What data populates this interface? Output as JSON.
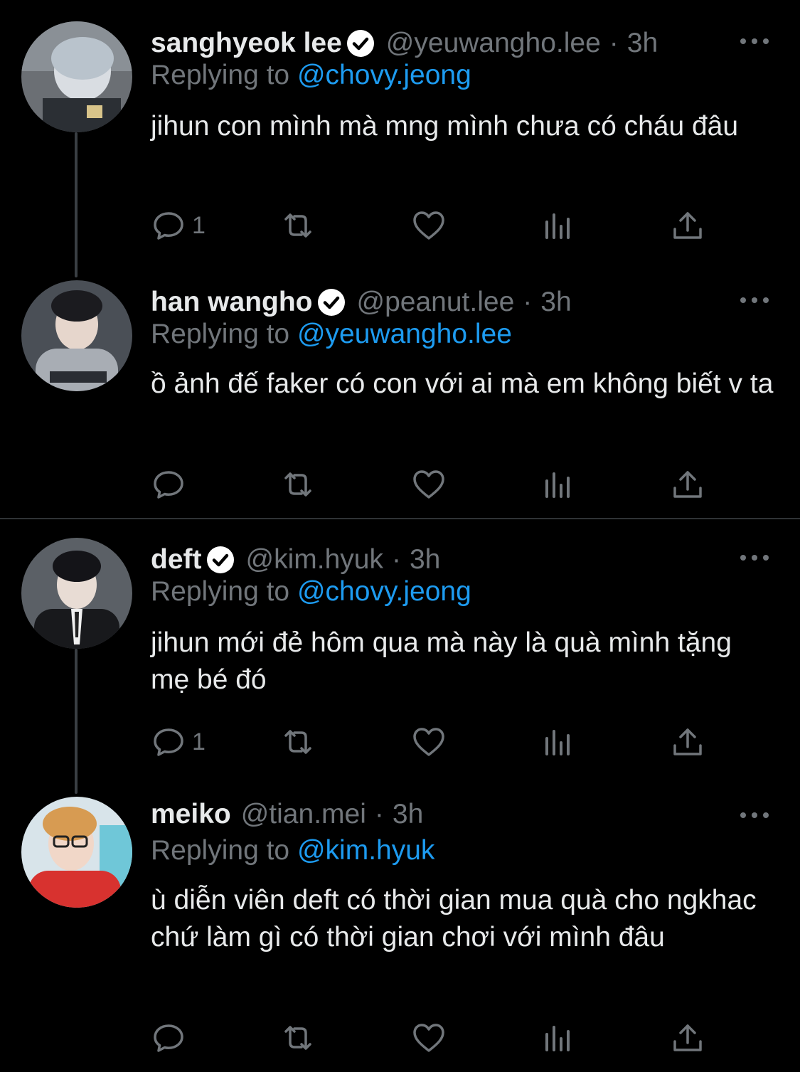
{
  "tweets": [
    {
      "name": "sanghyeok lee",
      "verified": true,
      "handle": "@yeuwangho.lee",
      "dot": "·",
      "time": "3h",
      "reply_prefix": "Replying to",
      "reply_to": "@chovy.jeong",
      "text": "jihun con mình mà mng mình chưa có cháu đâu",
      "reply_count": "1",
      "avatar_icon": "profile-photo"
    },
    {
      "name": "han wangho",
      "verified": true,
      "handle": "@peanut.lee",
      "dot": "·",
      "time": "3h",
      "reply_prefix": "Replying to",
      "reply_to": "@yeuwangho.lee",
      "text": "ồ ảnh đế faker có con với ai mà em không biết v ta",
      "reply_count": "",
      "avatar_icon": "profile-photo"
    },
    {
      "name": "deft",
      "verified": true,
      "handle": "@kim.hyuk",
      "dot": "·",
      "time": "3h",
      "reply_prefix": "Replying to",
      "reply_to": "@chovy.jeong",
      "text": "jihun mới đẻ hôm qua mà này là quà mình tặng mẹ bé đó",
      "reply_count": "1",
      "avatar_icon": "profile-photo"
    },
    {
      "name": "meiko",
      "verified": false,
      "handle": "@tian.mei",
      "dot": "·",
      "time": "3h",
      "reply_prefix": "Replying to",
      "reply_to": "@kim.hyuk",
      "text": "ù diễn viên deft có thời gian mua quà cho ngkhac chứ làm gì có thời gian chơi với mình đâu",
      "reply_count": "",
      "avatar_icon": "profile-photo"
    }
  ],
  "icons": {
    "reply": "reply-icon",
    "retweet": "retweet-icon",
    "like": "heart-icon",
    "views": "views-icon",
    "share": "share-icon",
    "more": "more-icon",
    "verified": "verified-badge-icon"
  },
  "colors": {
    "background": "#000000",
    "text": "#e7e9ea",
    "secondary": "#71767b",
    "link": "#1d9bf0",
    "thread_line": "#3a3f44",
    "divider": "#2f3336"
  }
}
